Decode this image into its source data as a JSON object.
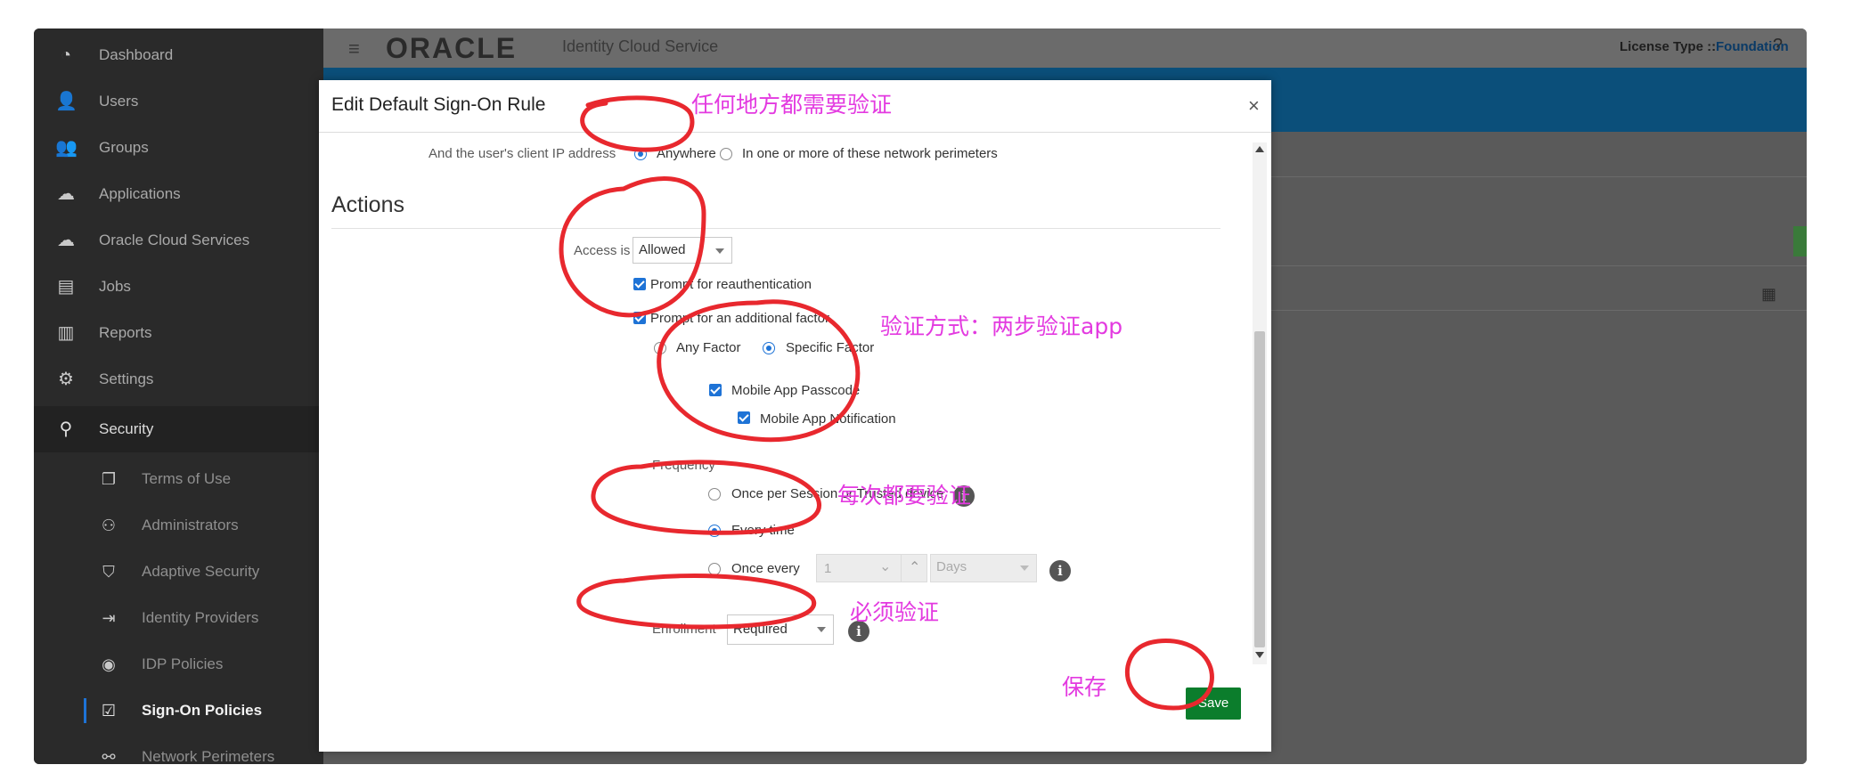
{
  "header": {
    "logo": "ORACLE",
    "product": "Identity Cloud Service",
    "license_label": "License Type ::",
    "license_value": "Foundation",
    "help": "?"
  },
  "sidebar": {
    "items": [
      {
        "label": "Dashboard",
        "icon": "dashboard-icon"
      },
      {
        "label": "Users",
        "icon": "user-icon"
      },
      {
        "label": "Groups",
        "icon": "groups-icon"
      },
      {
        "label": "Applications",
        "icon": "applications-icon"
      },
      {
        "label": "Oracle Cloud Services",
        "icon": "cloud-icon"
      },
      {
        "label": "Jobs",
        "icon": "jobs-icon"
      },
      {
        "label": "Reports",
        "icon": "reports-icon"
      },
      {
        "label": "Settings",
        "icon": "gear-icon"
      },
      {
        "label": "Security",
        "icon": "key-icon"
      }
    ],
    "security_sub": [
      {
        "label": "Terms of Use",
        "icon": "document-icon"
      },
      {
        "label": "Administrators",
        "icon": "admin-icon"
      },
      {
        "label": "Adaptive Security",
        "icon": "shield-icon"
      },
      {
        "label": "Identity Providers",
        "icon": "sign-in-icon"
      },
      {
        "label": "IDP Policies",
        "icon": "policy-icon"
      },
      {
        "label": "Sign-On Policies",
        "icon": "checklist-icon"
      },
      {
        "label": "Network Perimeters",
        "icon": "network-icon"
      }
    ]
  },
  "modal": {
    "title": "Edit Default Sign-On Rule",
    "close": "×",
    "client_ip_label": "And the user's client IP address",
    "ip_anywhere": "Anywhere",
    "ip_perimeters": "In one or more of these network perimeters",
    "actions_heading": "Actions",
    "access_label": "Access is",
    "access_value": "Allowed",
    "prompt_reauth": "Prompt for reauthentication",
    "prompt_factor": "Prompt for an additional factor",
    "any_factor": "Any Factor",
    "specific_factor": "Specific Factor",
    "mobile_passcode": "Mobile App Passcode",
    "mobile_notification": "Mobile App Notification",
    "frequency_label": "Frequency",
    "freq_session": "Once per Session or Trusted device",
    "freq_every": "Every time",
    "freq_once_every": "Once every",
    "freq_number": "1",
    "freq_unit": "Days",
    "enrollment_label": "Enrollment",
    "enrollment_value": "Required",
    "save": "Save"
  },
  "annotations": {
    "anywhere_note": "任何地方都需要验证",
    "method_note": "验证方式：两步验证app",
    "every_note": "每次都要验证",
    "required_note": "必须验证",
    "save_note": "保存"
  },
  "colors": {
    "annotation": "#e33ae0",
    "circle": "#e8282e",
    "save_button": "#0b7d2c",
    "link": "#1a5fb4"
  }
}
